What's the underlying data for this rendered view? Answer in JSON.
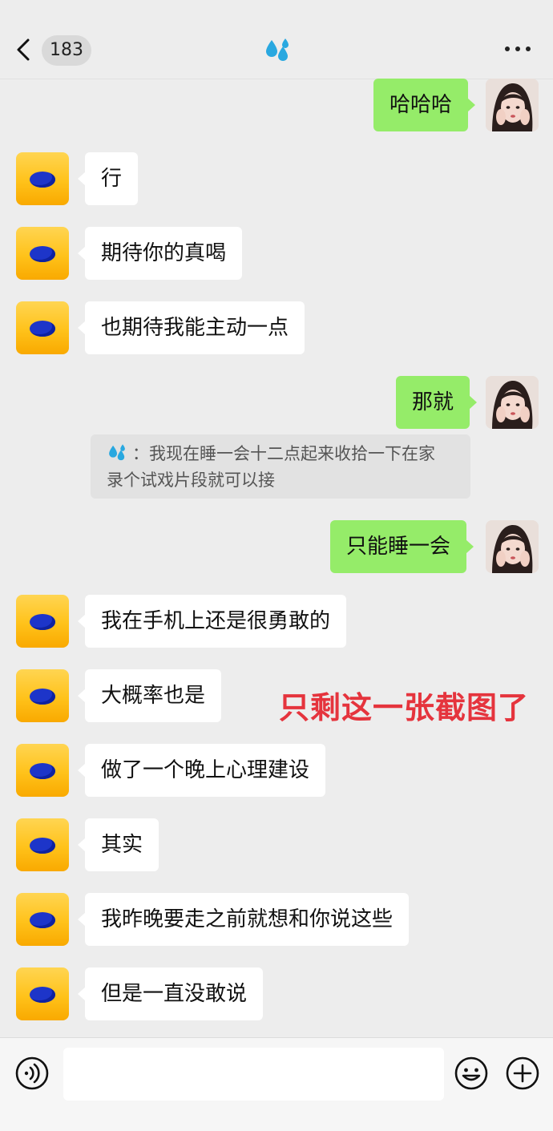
{
  "header": {
    "back_count": "183"
  },
  "messages": [
    {
      "dir": "out",
      "text": "哈哈哈"
    },
    {
      "dir": "in",
      "text": "行"
    },
    {
      "dir": "in",
      "text": "期待你的真喝"
    },
    {
      "dir": "in",
      "text": "也期待我能主动一点"
    },
    {
      "dir": "out",
      "text": "那就"
    },
    {
      "dir": "out",
      "text": "只能睡一会"
    },
    {
      "dir": "in",
      "text": "我在手机上还是很勇敢的"
    },
    {
      "dir": "in",
      "text": "大概率也是"
    },
    {
      "dir": "in",
      "text": "做了一个晚上心理建设"
    },
    {
      "dir": "in",
      "text": "其实"
    },
    {
      "dir": "in",
      "text": "我昨晚要走之前就想和你说这些"
    },
    {
      "dir": "in",
      "text": "但是一直没敢说"
    }
  ],
  "quote": {
    "line1": "：我现在睡一会十二点起来收拾一下在家",
    "line2": "录个试戏片段就可以接"
  },
  "overlay_text": "只剩这一张截图了",
  "colors": {
    "outgoing_bubble": "#95ec69",
    "incoming_bubble": "#ffffff",
    "overlay": "#e5343d"
  },
  "icons": [
    "back-chevron-icon",
    "sweat-drops-icon",
    "more-icon",
    "voice-icon",
    "emoji-icon",
    "plus-icon"
  ]
}
